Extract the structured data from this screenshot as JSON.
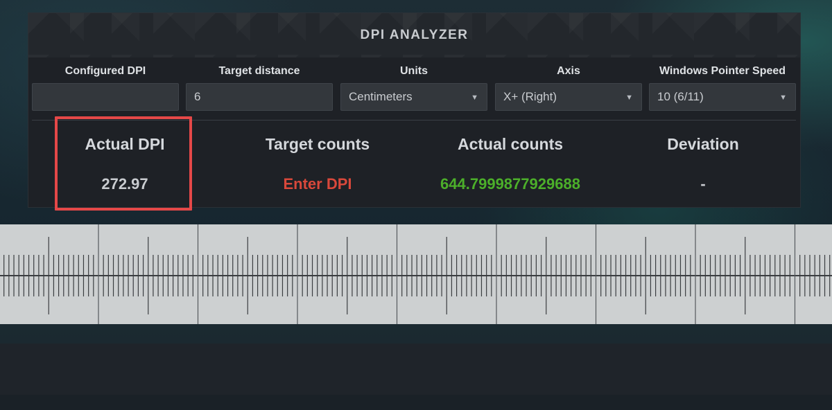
{
  "panel": {
    "title": "DPI ANALYZER"
  },
  "fields": {
    "configured_dpi": {
      "label": "Configured DPI",
      "value": ""
    },
    "target_distance": {
      "label": "Target distance",
      "value": "6"
    },
    "units": {
      "label": "Units",
      "value": "Centimeters"
    },
    "axis": {
      "label": "Axis",
      "value": "X+ (Right)"
    },
    "pointer_speed": {
      "label": "Windows Pointer Speed",
      "value": "10 (6/11)"
    }
  },
  "stats": {
    "actual_dpi": {
      "label": "Actual DPI",
      "value": "272.97"
    },
    "target_counts": {
      "label": "Target counts",
      "value": "Enter DPI"
    },
    "actual_counts": {
      "label": "Actual counts",
      "value": "644.7999877929688"
    },
    "deviation": {
      "label": "Deviation",
      "value": "-"
    }
  },
  "colors": {
    "error_text": "#d9483b",
    "success_text": "#4caf2a",
    "highlight_border": "#e54848"
  },
  "icons": {
    "dropdown": "caret-down-icon"
  }
}
